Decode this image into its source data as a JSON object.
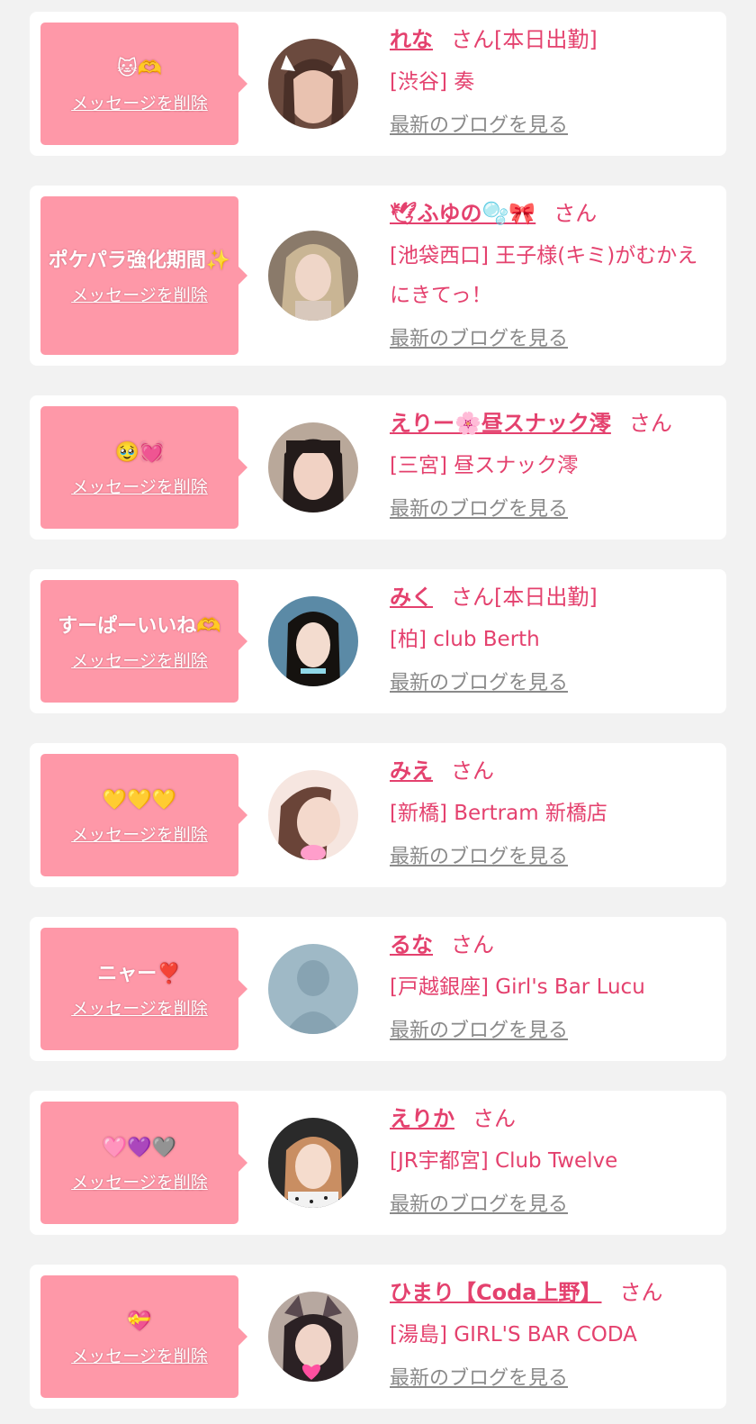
{
  "delete_label": "メッセージを削除",
  "blog_label": "最新のブログを見る",
  "entries": [
    {
      "message": "🐱🫶",
      "name": "れな",
      "suffix": "さん[本日出勤]",
      "shop": "[渋谷] 奏"
    },
    {
      "message": "ポケパラ強化期間✨",
      "name": "🕊ふゆの🫧🎀",
      "suffix": "さん",
      "shop": "[池袋西口] 王子様(キミ)がむかえにきてっ！"
    },
    {
      "message": "🥹💓",
      "name": "えりー🌸昼スナック澪",
      "suffix": "さん",
      "shop": "[三宮] 昼スナック澪"
    },
    {
      "message": "すーぱーいいね🫶",
      "name": "みく",
      "suffix": "さん[本日出勤]",
      "shop": "[柏] club Berth"
    },
    {
      "message": "💛💛💛",
      "name": "みえ",
      "suffix": "さん",
      "shop": "[新橋] Bertram 新橋店"
    },
    {
      "message": "ニャー❣️",
      "name": "るな",
      "suffix": "さん",
      "shop": "[戸越銀座] Girl's Bar Lucu"
    },
    {
      "message": "🩷💜🩶",
      "name": "えりか",
      "suffix": "さん",
      "shop": "[JR宇都宮] Club Twelve"
    },
    {
      "message": "💝",
      "name": "ひまり【Coda上野】",
      "suffix": "さん",
      "shop": "[湯島] GIRL'S BAR CODA"
    }
  ],
  "colors": {
    "background": "#f2f2f2",
    "card": "#ffffff",
    "bubble": "#fe98a8",
    "accent": "#e4416e",
    "link_gray": "#8a8a8a"
  },
  "photos": [
    "avatar-photo",
    "avatar-photo",
    "avatar-photo",
    "avatar-photo",
    "avatar-photo",
    "no-photo-placeholder",
    "avatar-photo",
    "avatar-photo"
  ]
}
